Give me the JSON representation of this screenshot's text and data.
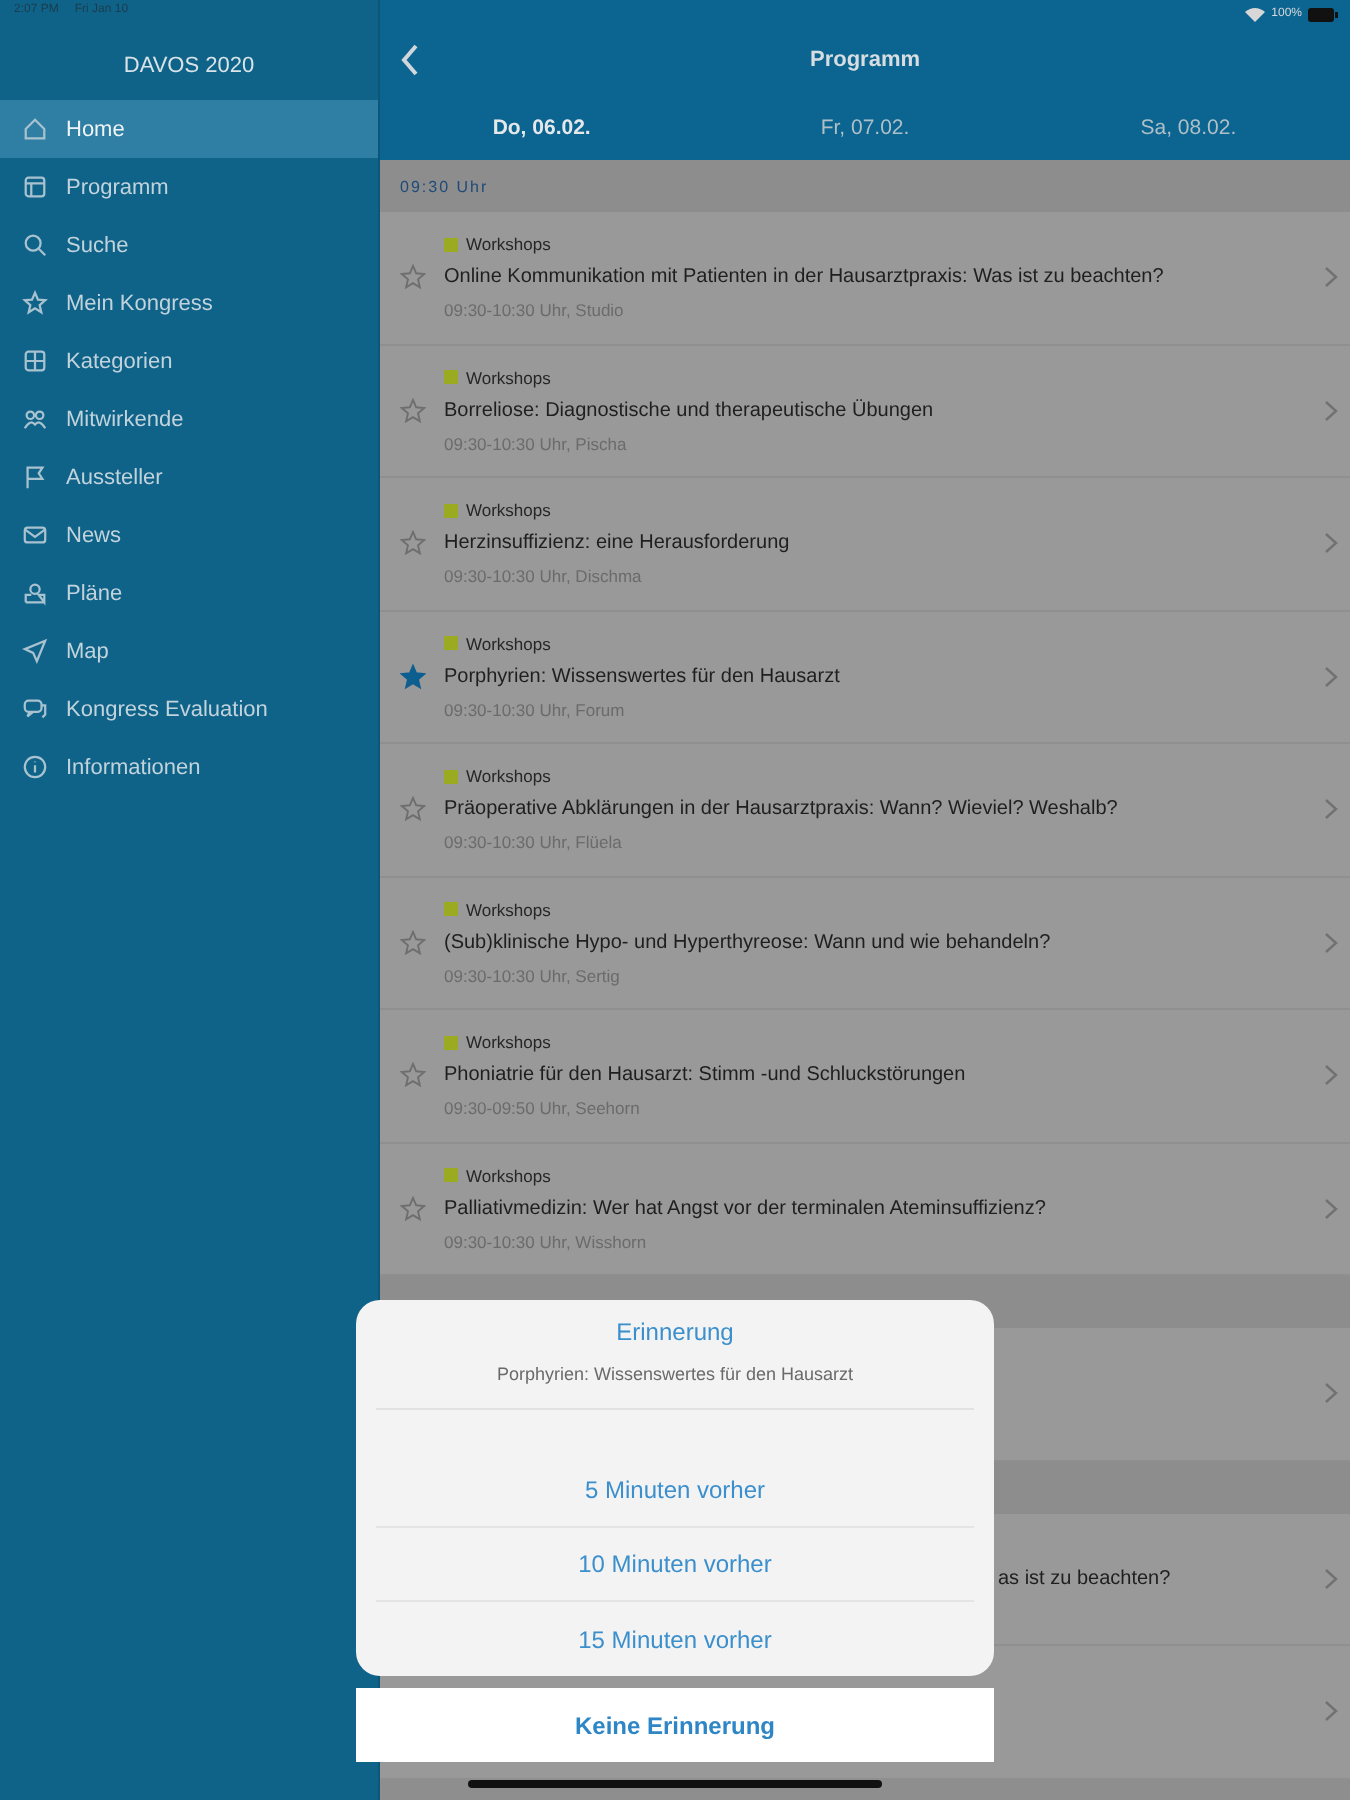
{
  "status_bar": {
    "time": "2:07 PM",
    "date": "Fri Jan 10",
    "battery": "100%"
  },
  "sidebar": {
    "title": "DAVOS 2020",
    "items": [
      {
        "label": "Home",
        "selected": true
      },
      {
        "label": "Programm",
        "selected": false
      },
      {
        "label": "Suche",
        "selected": false
      },
      {
        "label": "Mein Kongress",
        "selected": false
      },
      {
        "label": "Kategorien",
        "selected": false
      },
      {
        "label": "Mitwirkende",
        "selected": false
      },
      {
        "label": "Aussteller",
        "selected": false
      },
      {
        "label": "News",
        "selected": false
      },
      {
        "label": "Pläne",
        "selected": false
      },
      {
        "label": "Map",
        "selected": false
      },
      {
        "label": "Kongress Evaluation",
        "selected": false
      },
      {
        "label": "Informationen",
        "selected": false
      }
    ]
  },
  "header": {
    "title": "Programm",
    "tabs": [
      {
        "label": "Do, 06.02.",
        "selected": true
      },
      {
        "label": "Fr, 07.02.",
        "selected": false
      },
      {
        "label": "Sa, 08.02.",
        "selected": false
      }
    ]
  },
  "sessions": {
    "section": "09:30 Uhr",
    "rows": [
      {
        "category": "Workshops",
        "title": "Online Kommunikation mit Patienten in der Hausarztpraxis: Was ist zu beachten?",
        "info": "09:30-10:30 Uhr, Studio",
        "starred": false
      },
      {
        "category": "Workshops",
        "title": "Borreliose: Diagnostische und therapeutische Übungen",
        "info": "09:30-10:30 Uhr, Pischa",
        "starred": false
      },
      {
        "category": "Workshops",
        "title": "Herzinsuffizienz: eine Herausforderung",
        "info": "09:30-10:30 Uhr, Dischma",
        "starred": false
      },
      {
        "category": "Workshops",
        "title": "Porphyrien: Wissenswertes für den Hausarzt",
        "info": "09:30-10:30 Uhr, Forum",
        "starred": true
      },
      {
        "category": "Workshops",
        "title": "Präoperative Abklärungen in der Hausarztpraxis: Wann? Wieviel? Weshalb?",
        "info": "09:30-10:30 Uhr, Flüela",
        "starred": false
      },
      {
        "category": "Workshops",
        "title": "(Sub)klinische Hypo- und Hyperthyreose: Wann und wie behandeln?",
        "info": "09:30-10:30 Uhr, Sertig",
        "starred": false
      },
      {
        "category": "Workshops",
        "title": "Phoniatrie für den Hausarzt: Stimm -und Schluckstörungen",
        "info": "09:30-09:50 Uhr, Seehorn",
        "starred": false
      },
      {
        "category": "Workshops",
        "title": "Palliativmedizin: Wer hat Angst vor der terminalen Ateminsuffizienz?",
        "info": "09:30-10:30 Uhr, Wisshorn",
        "starred": false
      }
    ]
  },
  "covered_row_title_tail": "as ist zu beachten?",
  "reminder_sheet": {
    "title": "Erinnerung",
    "subtitle": "Porphyrien: Wissenswertes für den Hausarzt",
    "options": [
      "5 Minuten vorher",
      "10 Minuten vorher",
      "15 Minuten vorher"
    ],
    "cancel": "Keine Erinnerung"
  }
}
